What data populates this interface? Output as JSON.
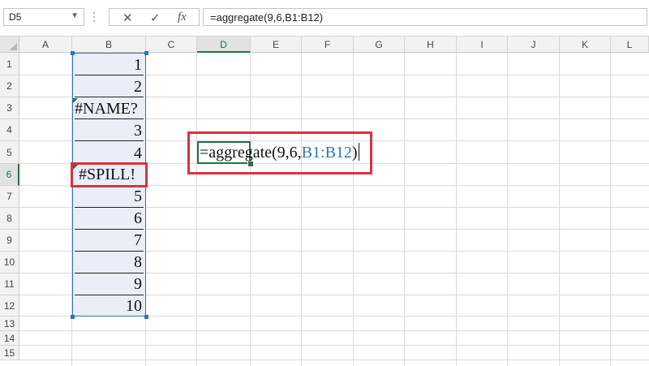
{
  "name_box": {
    "value": "D5"
  },
  "formula_bar": {
    "cancel_glyph": "✕",
    "enter_glyph": "✓",
    "fx_glyph": "fx",
    "formula": "=aggregate(9,6,B1:B12)"
  },
  "columns": [
    "A",
    "B",
    "C",
    "D",
    "E",
    "F",
    "G",
    "H",
    "I",
    "J",
    "K",
    "L"
  ],
  "rows": [
    "1",
    "2",
    "3",
    "4",
    "5",
    "6",
    "7",
    "8",
    "9",
    "10",
    "11",
    "12",
    "13",
    "14",
    "15"
  ],
  "active_column": "D",
  "active_row": "5",
  "column_b_values": [
    "1",
    "2",
    "#NAME?",
    "3",
    "4",
    "#SPILL!",
    "5",
    "6",
    "7",
    "8",
    "9",
    "10"
  ],
  "in_cell_edit": {
    "prefix": "=aggregate(9,6,",
    "reference": "B1:B12",
    "suffix": ")"
  },
  "colors": {
    "accent_green": "#217346",
    "reference_blue": "#2e75b6",
    "highlight_red": "#d9333f",
    "range_fill": "#e9eff8"
  }
}
